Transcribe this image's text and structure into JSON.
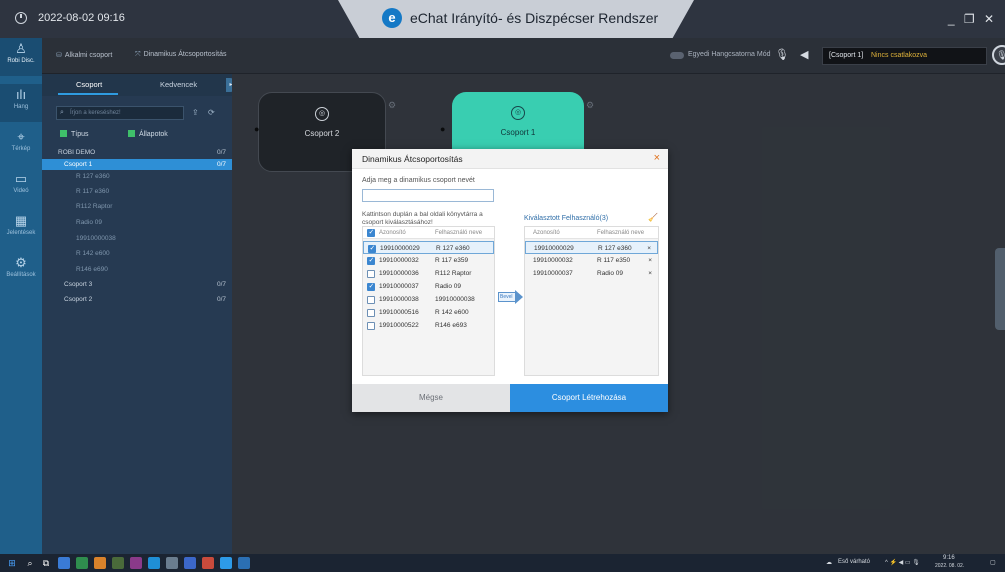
{
  "titlebar": {
    "datetime": "2022-08-02 09:16",
    "app_title": "eChat Irányító- és Diszpécser Rendszer",
    "logo_letter": "e",
    "window_controls": "_ ❐ ✕"
  },
  "leftnav": {
    "items": [
      {
        "label": "Robi Disc.",
        "icon": "user-icon",
        "glyph": "♙"
      },
      {
        "label": "Hang",
        "icon": "audio-wave-icon",
        "glyph": "ılı"
      },
      {
        "label": "Térkép",
        "icon": "map-icon",
        "glyph": "⌖"
      },
      {
        "label": "Videó",
        "icon": "video-icon",
        "glyph": "▭"
      },
      {
        "label": "Jelentések",
        "icon": "report-icon",
        "glyph": "▦"
      },
      {
        "label": "Beállítások",
        "icon": "settings-icon",
        "glyph": "⚙"
      }
    ]
  },
  "subbar": {
    "temp_group": "Alkalmi csoport",
    "dynamic_regroup": "Dinamikus Átcsoportosítás",
    "mode_label": "Egyedi Hangcsatorna Mód",
    "status_group": "[Csoport 1]",
    "status_text": "Nincs csatlakozva"
  },
  "tree": {
    "tabs": [
      "Csoport",
      "Kedvencek"
    ],
    "search_placeholder": "Írjon a kereséshez!",
    "chips": [
      "Típus",
      "Állapotok"
    ],
    "rows": [
      {
        "label": "ROBI DEMO",
        "count": "0/7",
        "kind": "root"
      },
      {
        "label": "Csoport 1",
        "count": "0/7",
        "kind": "selected"
      },
      {
        "label": "R 127 e360",
        "count": "",
        "kind": "member"
      },
      {
        "label": "R 117 e360",
        "count": "",
        "kind": "member"
      },
      {
        "label": "R112 Raptor",
        "count": "",
        "kind": "member"
      },
      {
        "label": "Radio 09",
        "count": "",
        "kind": "member"
      },
      {
        "label": "19910000038",
        "count": "",
        "kind": "member"
      },
      {
        "label": "R 142 e600",
        "count": "",
        "kind": "member"
      },
      {
        "label": "R146 e690",
        "count": "",
        "kind": "member"
      },
      {
        "label": "Csoport 3",
        "count": "0/7",
        "kind": "group"
      },
      {
        "label": "Csoport 2",
        "count": "0/7",
        "kind": "group"
      }
    ]
  },
  "canvas": {
    "groups": [
      {
        "label": "Csoport 2"
      },
      {
        "label": "Csoport 1"
      }
    ]
  },
  "modal": {
    "title": "Dinamikus Átcsoportosítás",
    "close": "×",
    "prompt": "Adja meg a dinamikus csoport nevét",
    "name_value": "",
    "instruction": "Kattintson duplán a bal oldali könyvtárra a csoport kiválasztásához!",
    "left_headers": [
      "Azonosító",
      "Felhasználó neve"
    ],
    "left_rows": [
      {
        "id": "19910000029",
        "name": "R 127 e360",
        "checked": true,
        "highlight": true
      },
      {
        "id": "19910000032",
        "name": "R 117 e359",
        "checked": true,
        "highlight": false
      },
      {
        "id": "19910000036",
        "name": "R112 Raptor",
        "checked": false,
        "highlight": false
      },
      {
        "id": "19910000037",
        "name": "Radio 09",
        "checked": true,
        "highlight": false
      },
      {
        "id": "19910000038",
        "name": "19910000038",
        "checked": false,
        "highlight": false
      },
      {
        "id": "19910000516",
        "name": "R 142 e600",
        "checked": false,
        "highlight": false
      },
      {
        "id": "19910000522",
        "name": "R146 e693",
        "checked": false,
        "highlight": false
      }
    ],
    "add_label": "Bevel",
    "selected_title": "Kiválasztott Felhasználó(3)",
    "right_headers": [
      "Azonosító",
      "Felhasználó neve"
    ],
    "right_rows": [
      {
        "id": "19910000029",
        "name": "R 127 e360",
        "highlight": true
      },
      {
        "id": "19910000032",
        "name": "R 117 e350",
        "highlight": false
      },
      {
        "id": "19910000037",
        "name": "Radio 09",
        "highlight": false
      }
    ],
    "cancel_label": "Mégse",
    "create_label": "Csoport Létrehozása"
  },
  "taskbar": {
    "weather": "Eső várható",
    "time": "9:16",
    "date": "2022. 08. 02."
  },
  "colors": {
    "accent": "#2c8ee0",
    "group1_card": "#3ee0c0",
    "status_warn": "#e0b33a"
  }
}
